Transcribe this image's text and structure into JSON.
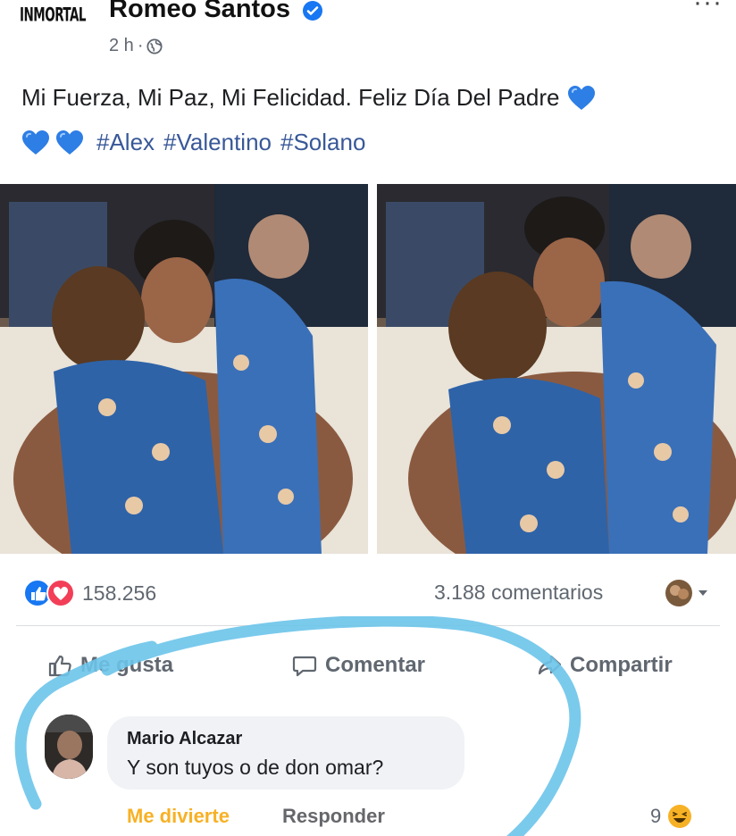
{
  "post": {
    "logo_text": "INMORTAL",
    "author": "Romeo Santos",
    "time": "2 h",
    "separator": "·",
    "more_icon": "more-horizontal-icon",
    "caption": "Mi Fuerza, Mi Paz, Mi Felicidad. Feliz Día Del Padre",
    "hashtags": [
      "#Alex",
      "#Valentino",
      "#Solano"
    ]
  },
  "stats": {
    "reactions_count": "158.256",
    "comments_count": "3.188 comentarios"
  },
  "actions": {
    "like": "Me gusta",
    "comment": "Comentar",
    "share": "Compartir"
  },
  "comment": {
    "author": "Mario Alcazar",
    "text": "Y son tuyos o de don omar?",
    "reaction_label": "Me divierte",
    "reply_label": "Responder",
    "reaction_count": "9"
  },
  "colors": {
    "accent": "#1877f2",
    "hashtag": "#385898",
    "haha": "#f7b125",
    "marker": "#6cc4ea"
  }
}
